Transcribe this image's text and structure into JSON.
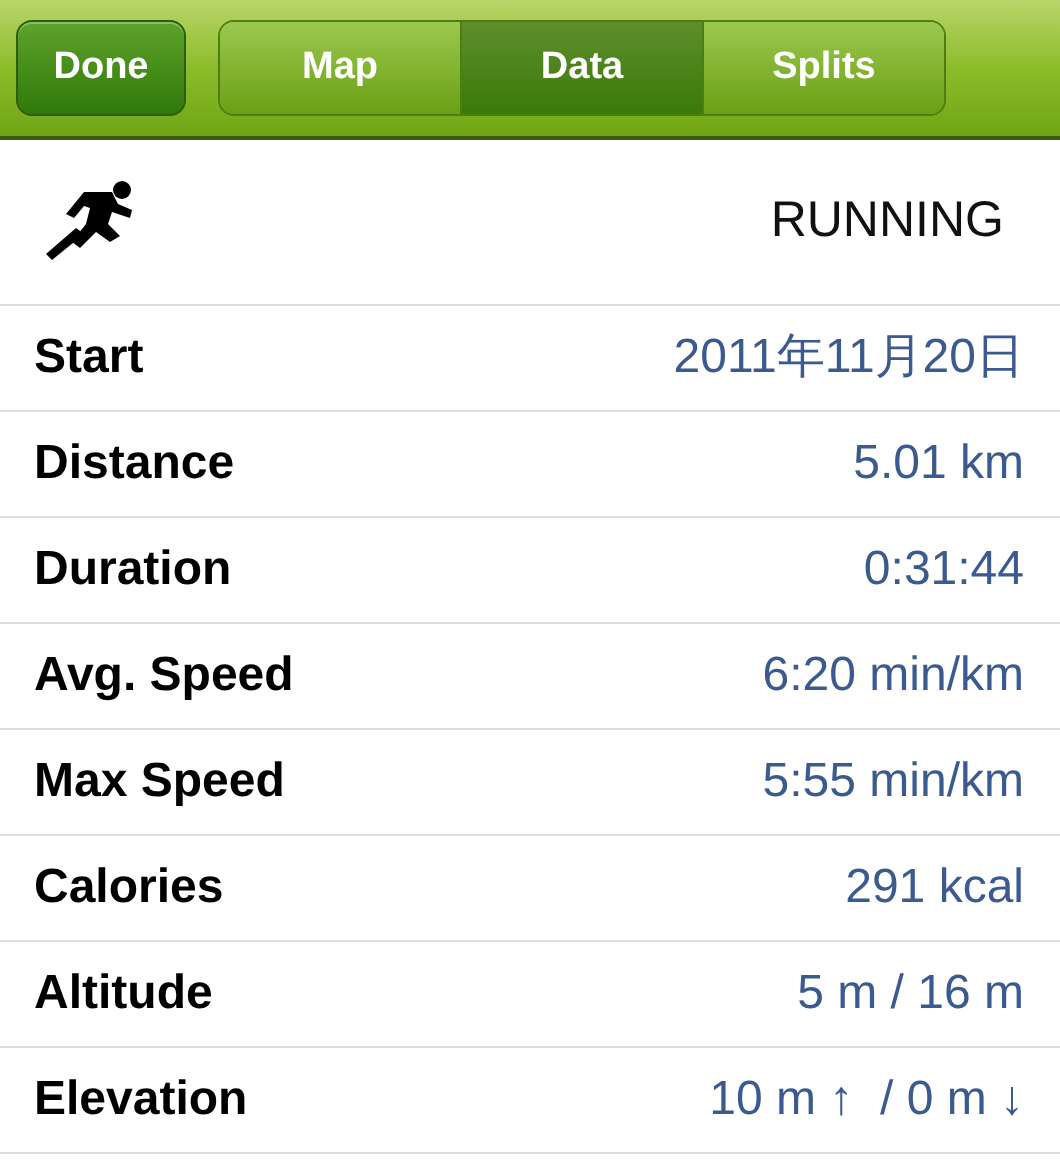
{
  "toolbar": {
    "done_button": "Done",
    "segments": [
      {
        "label": "Map",
        "selected": false
      },
      {
        "label": "Data",
        "selected": true
      },
      {
        "label": "Splits",
        "selected": false
      }
    ]
  },
  "activity": {
    "name": "RUNNING"
  },
  "rows": [
    {
      "label": "Start",
      "value": "2011年11月20日"
    },
    {
      "label": "Distance",
      "value": "5.01 km"
    },
    {
      "label": "Duration",
      "value": "0:31:44"
    },
    {
      "label": "Avg. Speed",
      "value": "6:20 min/km"
    },
    {
      "label": "Max Speed",
      "value": "5:55 min/km"
    },
    {
      "label": "Calories",
      "value": "291 kcal"
    },
    {
      "label": "Altitude",
      "value": "5 m / 16 m"
    },
    {
      "label": "Elevation",
      "value": "10 m ↑  / 0 m ↓"
    }
  ]
}
